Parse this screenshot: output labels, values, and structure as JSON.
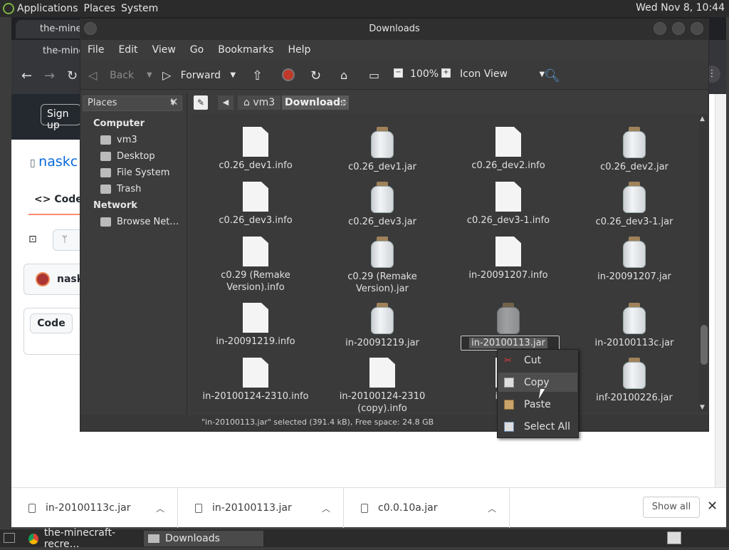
{
  "top_panel": {
    "menus": [
      "Applications",
      "Places",
      "System"
    ],
    "clock": "Wed Nov  8, 10:44"
  },
  "browser": {
    "tab1": "the-minec",
    "tab2": "the-mine",
    "signup": "Sign up",
    "repo": "naskc",
    "code_tab": "Code",
    "user": "nask",
    "code_btn": "Code"
  },
  "window": {
    "title": "Downloads",
    "menus": [
      "File",
      "Edit",
      "View",
      "Go",
      "Bookmarks",
      "Help"
    ],
    "toolbar": {
      "back": "Back",
      "forward": "Forward",
      "zoom": "100%",
      "view": "Icon View"
    },
    "places_label": "Places",
    "sidebar": {
      "computer_hdr": "Computer",
      "computer": [
        "vm3",
        "Desktop",
        "File System",
        "Trash"
      ],
      "network_hdr": "Network",
      "network": [
        "Browse Net…"
      ]
    },
    "path": [
      "vm3",
      "Downloads"
    ],
    "files": [
      {
        "name": "c0.26_dev1.info",
        "type": "doc"
      },
      {
        "name": "c0.26_dev1.jar",
        "type": "jar"
      },
      {
        "name": "c0.26_dev2.info",
        "type": "doc"
      },
      {
        "name": "c0.26_dev2.jar",
        "type": "jar"
      },
      {
        "name": "c0.26_dev3.info",
        "type": "doc"
      },
      {
        "name": "c0.26_dev3.jar",
        "type": "jar"
      },
      {
        "name": "c0.26_dev3-1.info",
        "type": "doc"
      },
      {
        "name": "c0.26_dev3-1.jar",
        "type": "jar"
      },
      {
        "name": "c0.29 (Remake Version).info",
        "type": "doc"
      },
      {
        "name": "c0.29 (Remake Version).jar",
        "type": "jar"
      },
      {
        "name": "in-20091207.info",
        "type": "doc"
      },
      {
        "name": "in-20091207.jar",
        "type": "jar"
      },
      {
        "name": "in-20091219.info",
        "type": "doc"
      },
      {
        "name": "in-20091219.jar",
        "type": "jar"
      },
      {
        "name": "in-20100113.jar",
        "type": "jar",
        "selected": true
      },
      {
        "name": "in-20100113c.jar",
        "type": "jar"
      },
      {
        "name": "in-20100124-2310.info",
        "type": "doc"
      },
      {
        "name": "in-20100124-2310 (copy).info",
        "type": "doc"
      },
      {
        "name": "inf-20",
        "type": "doc"
      },
      {
        "name": "inf-20100226.jar",
        "type": "jar"
      }
    ],
    "status": "\"in-20100113.jar\" selected (391.4 kB), Free space: 24.8 GB"
  },
  "context_menu": {
    "items": [
      "Cut",
      "Copy",
      "Paste",
      "Select All"
    ],
    "highlighted": "Copy"
  },
  "downloads_shelf": {
    "items": [
      "in-20100113c.jar",
      "in-20100113.jar",
      "c0.0.10a.jar"
    ],
    "show_all": "Show all"
  },
  "taskbar": {
    "items": [
      "the-minecraft-recre…",
      "Downloads"
    ]
  }
}
